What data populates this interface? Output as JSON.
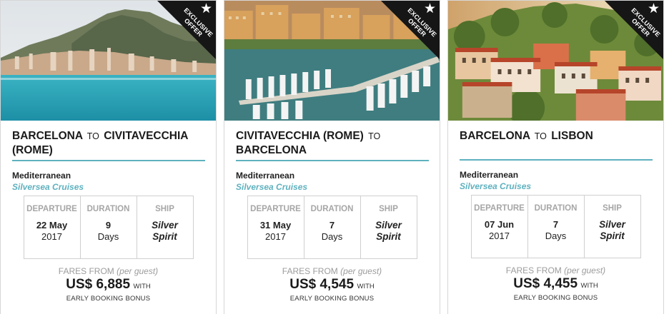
{
  "cards": [
    {
      "ribbon": {
        "line1": "EXCLUSIVE",
        "line2": "OFFER",
        "star": "★"
      },
      "route": {
        "from": "BARCELONA",
        "to_word": "TO",
        "to": "CIVITAVECCHIA (ROME)"
      },
      "region": "Mediterranean",
      "cruise_line": "Silversea Cruises",
      "headers": {
        "departure": "DEPARTURE",
        "duration": "DURATION",
        "ship": "SHIP"
      },
      "departure": {
        "day_month": "22 May",
        "year": "2017"
      },
      "duration": {
        "number": "9",
        "unit": "Days"
      },
      "ship": {
        "line1": "Silver",
        "line2": "Spirit"
      },
      "fares_label": "FARES FROM",
      "per_guest": "(per guest)",
      "price": "US$ 6,885",
      "with": "WITH",
      "bonus": "EARLY BOOKING BONUS",
      "photo": "monaco-coast-photo"
    },
    {
      "ribbon": {
        "line1": "EXCLUSIVE",
        "line2": "OFFER",
        "star": "★"
      },
      "route": {
        "from": "CIVITAVECCHIA (ROME)",
        "to_word": "TO",
        "to": "BARCELONA"
      },
      "region": "Mediterranean",
      "cruise_line": "Silversea Cruises",
      "headers": {
        "departure": "DEPARTURE",
        "duration": "DURATION",
        "ship": "SHIP"
      },
      "departure": {
        "day_month": "31 May",
        "year": "2017"
      },
      "duration": {
        "number": "7",
        "unit": "Days"
      },
      "ship": {
        "line1": "Silver",
        "line2": "Spirit"
      },
      "fares_label": "FARES FROM",
      "per_guest": "(per guest)",
      "price": "US$ 4,545",
      "with": "WITH",
      "bonus": "EARLY BOOKING BONUS",
      "photo": "marina-harbor-photo"
    },
    {
      "ribbon": {
        "line1": "EXCLUSIVE",
        "line2": "OFFER",
        "star": "★"
      },
      "route": {
        "from": "BARCELONA",
        "to_word": "TO",
        "to": "LISBON"
      },
      "region": "Mediterranean",
      "cruise_line": "Silversea Cruises",
      "headers": {
        "departure": "DEPARTURE",
        "duration": "DURATION",
        "ship": "SHIP"
      },
      "departure": {
        "day_month": "07 Jun",
        "year": "2017"
      },
      "duration": {
        "number": "7",
        "unit": "Days"
      },
      "ship": {
        "line1": "Silver",
        "line2": "Spirit"
      },
      "fares_label": "FARES FROM",
      "per_guest": "(per guest)",
      "price": "US$ 4,455",
      "with": "WITH",
      "bonus": "EARLY BOOKING BONUS",
      "photo": "lisbon-hillside-photo"
    }
  ],
  "colors": {
    "accent": "#5eb1bf",
    "ribbon": "#161616",
    "header_gray": "#a6a6a6",
    "border": "#d6d6d6"
  }
}
